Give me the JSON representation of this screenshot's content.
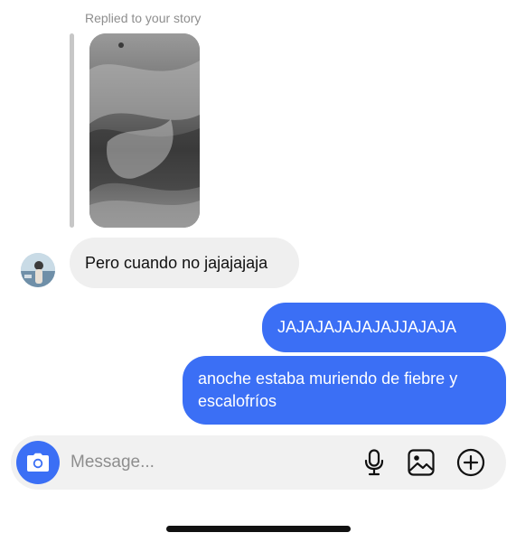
{
  "reply": {
    "label": "Replied to your story"
  },
  "messages": {
    "incoming": [
      {
        "text": "Pero cuando no jajajajaja"
      }
    ],
    "outgoing": [
      {
        "text": "JAJAJAJAJAJAJJAJAJA"
      },
      {
        "text": "anoche estaba muriendo de fiebre y escalofríos"
      }
    ]
  },
  "composer": {
    "placeholder": "Message...",
    "icons": [
      "camera-icon",
      "microphone-icon",
      "gallery-icon",
      "plus-circle-icon"
    ]
  },
  "colors": {
    "outgoing_bubble": "#3b6ff5",
    "incoming_bubble": "#efefef",
    "accent": "#3b6ff5"
  }
}
